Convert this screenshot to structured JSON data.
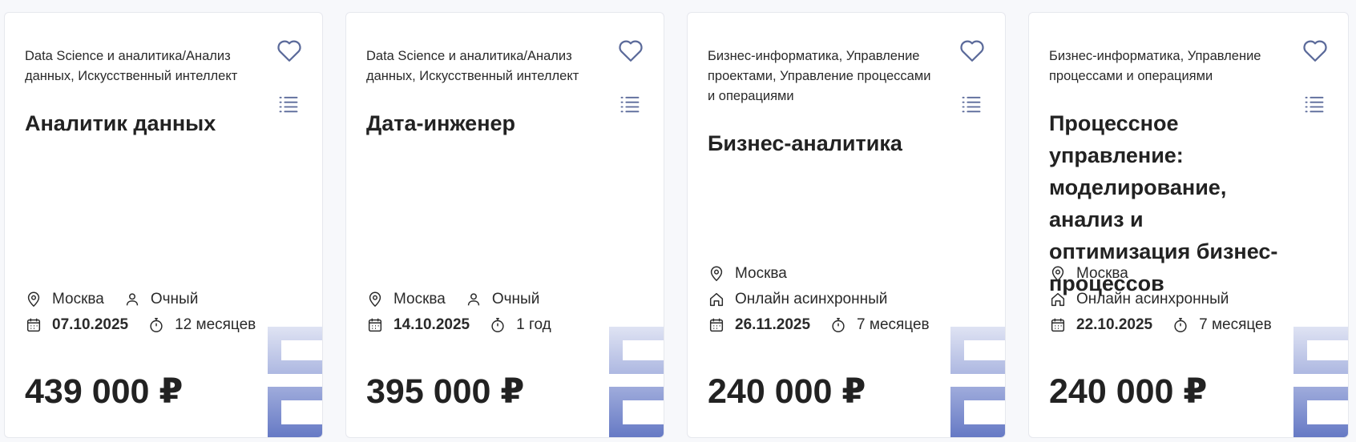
{
  "colors": {
    "accent": "#6b7ec2",
    "icon": "#5b6a9a",
    "text": "#222222"
  },
  "cards": [
    {
      "tags": "Data Science и аналитика/Анализ данных, Искусственный интеллект",
      "title": "Аналитик данных",
      "city": "Москва",
      "format": "Очный",
      "date": "07.10.2025",
      "duration": "12 месяцев",
      "price": "439 000 ₽"
    },
    {
      "tags": "Data Science и аналитика/Анализ данных, Искусственный интеллект",
      "title": "Дата-инженер",
      "city": "Москва",
      "format": "Очный",
      "date": "14.10.2025",
      "duration": "1 год",
      "price": "395 000 ₽"
    },
    {
      "tags": "Бизнес-информатика, Управление проектами, Управление процессами и операциями",
      "title": "Бизнес-аналитика",
      "city": "Москва",
      "format": "Онлайн асинхронный",
      "date": "26.11.2025",
      "duration": "7 месяцев",
      "price": "240 000 ₽"
    },
    {
      "tags": "Бизнес-информатика, Управление процессами и операциями",
      "title": "Процессное управление: моделирование, анализ и оптимизация бизнес-процессов",
      "city": "Москва",
      "format": "Онлайн асинхронный",
      "date": "22.10.2025",
      "duration": "7 месяцев",
      "price": "240 000 ₽"
    }
  ]
}
